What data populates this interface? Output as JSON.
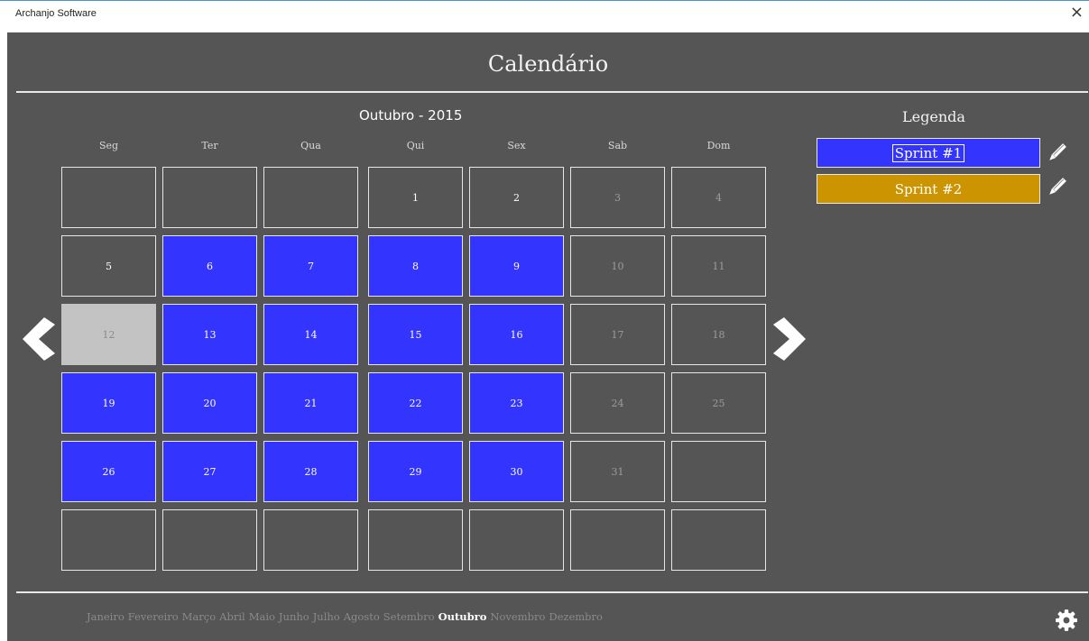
{
  "window": {
    "title": "Archanjo Software",
    "close_glyph": "×"
  },
  "page_title": "Calendário",
  "calendar": {
    "month_title": "Outubro - 2015",
    "weekdays": [
      "Seg",
      "Ter",
      "Qua",
      "Qui",
      "Sex",
      "Sab",
      "Dom"
    ],
    "weeks": [
      [
        {
          "day": ""
        },
        {
          "day": ""
        },
        {
          "day": ""
        },
        {
          "day": "1"
        },
        {
          "day": "2"
        },
        {
          "day": "3",
          "weekend": true
        },
        {
          "day": "4",
          "weekend": true
        }
      ],
      [
        {
          "day": "5"
        },
        {
          "day": "6",
          "sprint": 1
        },
        {
          "day": "7",
          "sprint": 1
        },
        {
          "day": "8",
          "sprint": 1
        },
        {
          "day": "9",
          "sprint": 1
        },
        {
          "day": "10",
          "weekend": true
        },
        {
          "day": "11",
          "weekend": true
        }
      ],
      [
        {
          "day": "12",
          "today": true
        },
        {
          "day": "13",
          "sprint": 1
        },
        {
          "day": "14",
          "sprint": 1
        },
        {
          "day": "15",
          "sprint": 1
        },
        {
          "day": "16",
          "sprint": 1
        },
        {
          "day": "17",
          "weekend": true
        },
        {
          "day": "18",
          "weekend": true
        }
      ],
      [
        {
          "day": "19",
          "sprint": 1
        },
        {
          "day": "20",
          "sprint": 1
        },
        {
          "day": "21",
          "sprint": 1
        },
        {
          "day": "22",
          "sprint": 1
        },
        {
          "day": "23",
          "sprint": 1
        },
        {
          "day": "24",
          "weekend": true
        },
        {
          "day": "25",
          "weekend": true
        }
      ],
      [
        {
          "day": "26",
          "sprint": 1
        },
        {
          "day": "27",
          "sprint": 1
        },
        {
          "day": "28",
          "sprint": 1
        },
        {
          "day": "29",
          "sprint": 1
        },
        {
          "day": "30",
          "sprint": 1
        },
        {
          "day": "31",
          "weekend": true
        },
        {
          "day": ""
        }
      ],
      [
        {
          "day": ""
        },
        {
          "day": ""
        },
        {
          "day": ""
        },
        {
          "day": ""
        },
        {
          "day": ""
        },
        {
          "day": ""
        },
        {
          "day": ""
        }
      ]
    ]
  },
  "legend": {
    "title": "Legenda",
    "items": [
      {
        "label": "Sprint #1",
        "color": "#3434ff"
      },
      {
        "label": "Sprint #2",
        "color": "#cc9400"
      }
    ]
  },
  "months": [
    "Janeiro",
    "Fevereiro",
    "Março",
    "Abril",
    "Maio",
    "Junho",
    "Julho",
    "Agosto",
    "Setembro",
    "Outubro",
    "Novembro",
    "Dezembro"
  ],
  "active_month": "Outubro",
  "icons": {
    "prev": "chevron-left-icon",
    "next": "chevron-right-icon",
    "edit": "pencil-icon",
    "settings": "gear-icon"
  },
  "colors": {
    "background": "#555555",
    "sprint1": "#3434ff",
    "sprint2": "#cc9400",
    "today": "#c3c3c3"
  }
}
